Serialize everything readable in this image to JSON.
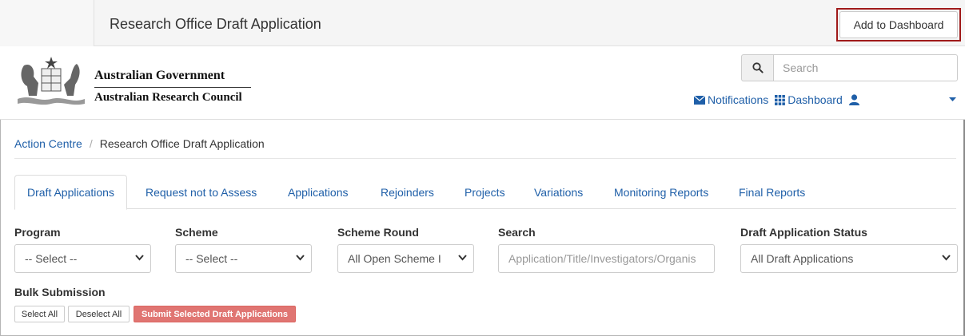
{
  "topbar": {
    "title": "Research Office Draft Application",
    "add_dashboard_label": "Add to Dashboard"
  },
  "header": {
    "gov_line1": "Australian Government",
    "gov_line2": "Australian Research Council",
    "search_placeholder": "Search",
    "notifications_label": "Notifications",
    "dashboard_label": "Dashboard"
  },
  "breadcrumb": {
    "root": "Action Centre",
    "separator": "/",
    "current": "Research Office Draft Application"
  },
  "tabs": [
    {
      "label": "Draft Applications",
      "active": true
    },
    {
      "label": "Request not to Assess",
      "active": false
    },
    {
      "label": "Applications",
      "active": false
    },
    {
      "label": "Rejoinders",
      "active": false
    },
    {
      "label": "Projects",
      "active": false
    },
    {
      "label": "Variations",
      "active": false
    },
    {
      "label": "Monitoring Reports",
      "active": false
    },
    {
      "label": "Final Reports",
      "active": false
    }
  ],
  "filters": {
    "program": {
      "label": "Program",
      "value": "-- Select --"
    },
    "scheme": {
      "label": "Scheme",
      "value": "-- Select --"
    },
    "scheme_round": {
      "label": "Scheme Round",
      "value": "All Open Scheme I"
    },
    "search": {
      "label": "Search",
      "placeholder": "Application/Title/Investigators/Organis"
    },
    "status": {
      "label": "Draft Application Status",
      "value": "All Draft Applications"
    }
  },
  "bulk": {
    "label": "Bulk Submission",
    "select_all": "Select All",
    "deselect_all": "Deselect All",
    "submit_selected": "Submit Selected Draft Applications"
  },
  "colors": {
    "link": "#1f5fa8",
    "highlight_border": "#a01a1a",
    "danger": "#d9534f"
  }
}
